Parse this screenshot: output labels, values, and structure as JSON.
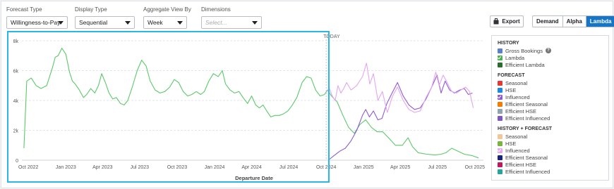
{
  "filters": [
    {
      "key": "forecast_type",
      "label": "Forecast Type",
      "value": "Willingness-to-Pay",
      "placeholder": ""
    },
    {
      "key": "display_type",
      "label": "Display Type",
      "value": "Sequential",
      "placeholder": ""
    },
    {
      "key": "aggregate_view",
      "label": "Aggregate View By",
      "value": "Week",
      "placeholder": ""
    },
    {
      "key": "dimensions",
      "label": "Dimensions",
      "value": "",
      "placeholder": "Select..."
    }
  ],
  "toolbar": {
    "export_label": "Export",
    "modes": [
      "Demand",
      "Alpha",
      "Lambda"
    ],
    "active_mode": "Lambda"
  },
  "legend": {
    "groups": [
      {
        "title": "HISTORY",
        "items": [
          {
            "label": "Gross Bookings",
            "color": "#5b7fc9",
            "checked": false,
            "help": true
          },
          {
            "label": "Lambda",
            "color": "#4caf50",
            "checked": true,
            "help": false
          },
          {
            "label": "Efficient Lambda",
            "color": "#2e6b2e",
            "checked": false,
            "help": false
          }
        ]
      },
      {
        "title": "FORECAST",
        "items": [
          {
            "label": "Seasonal",
            "color": "#e53935",
            "checked": false
          },
          {
            "label": "HSE",
            "color": "#1e88e5",
            "checked": false
          },
          {
            "label": "Influenced",
            "color": "#8e5bd1",
            "checked": true
          },
          {
            "label": "Efficient Seasonal",
            "color": "#f57c00",
            "checked": false
          },
          {
            "label": "Efficient HSE",
            "color": "#90a4ae",
            "checked": false
          },
          {
            "label": "Efficient Influenced",
            "color": "#7e57c2",
            "checked": false
          }
        ]
      },
      {
        "title": "HISTORY + FORECAST",
        "items": [
          {
            "label": "Seasonal",
            "color": "#f5c59a",
            "checked": false
          },
          {
            "label": "HSE",
            "color": "#7cb342",
            "checked": false
          },
          {
            "label": "Influenced",
            "color": "#e7a7f0",
            "checked": true
          },
          {
            "label": "Efficient Seasonal",
            "color": "#1a237e",
            "checked": false
          },
          {
            "label": "Efficient HSE",
            "color": "#c2185b",
            "checked": false
          },
          {
            "label": "Efficient Influenced",
            "color": "#26a69a",
            "checked": false
          }
        ]
      }
    ]
  },
  "chart_data": {
    "type": "line",
    "xlabel": "Departure Date",
    "ylabel": "",
    "ylim": [
      0,
      8000
    ],
    "yticks": [
      0,
      2000,
      4000,
      6000,
      8000
    ],
    "ytick_labels": [
      "0",
      "2k",
      "4k",
      "6k",
      "8k"
    ],
    "xlim": [
      "2022-09-15",
      "2025-10-22"
    ],
    "xticks": [
      "2022-10-01",
      "2023-01-01",
      "2023-04-01",
      "2023-07-01",
      "2023-10-01",
      "2024-01-01",
      "2024-04-01",
      "2024-07-01",
      "2024-10-01",
      "2025-01-01",
      "2025-04-01",
      "2025-07-01",
      "2025-10-01"
    ],
    "xtick_labels": [
      "Oct 2022",
      "Jan 2023",
      "Apr 2023",
      "Jul 2023",
      "Oct 2023",
      "Jan 2024",
      "Apr 2024",
      "Jul 2024",
      "Oct 2024",
      "Jan 2025",
      "Apr 2025",
      "Jul 2025",
      "Oct 2025"
    ],
    "today_label": "TODAY",
    "today_date": "2024-10-01",
    "grid": true,
    "series": [
      {
        "name": "Lambda",
        "color": "#5cc96a",
        "points": [
          [
            "2022-09-20",
            800
          ],
          [
            "2022-09-27",
            5300
          ],
          [
            "2022-10-08",
            5500
          ],
          [
            "2022-10-20",
            5000
          ],
          [
            "2022-11-01",
            4800
          ],
          [
            "2022-11-15",
            5000
          ],
          [
            "2022-11-29",
            6200
          ],
          [
            "2022-12-06",
            6900
          ],
          [
            "2022-12-13",
            7000
          ],
          [
            "2022-12-22",
            7500
          ],
          [
            "2023-01-01",
            7100
          ],
          [
            "2023-01-10",
            5900
          ],
          [
            "2023-01-17",
            5300
          ],
          [
            "2023-01-24",
            5100
          ],
          [
            "2023-02-03",
            4700
          ],
          [
            "2023-02-13",
            4200
          ],
          [
            "2023-02-21",
            4400
          ],
          [
            "2023-03-03",
            4800
          ],
          [
            "2023-03-13",
            4500
          ],
          [
            "2023-03-22",
            5000
          ],
          [
            "2023-03-30",
            5800
          ],
          [
            "2023-04-08",
            5200
          ],
          [
            "2023-04-17",
            4500
          ],
          [
            "2023-04-26",
            4100
          ],
          [
            "2023-05-05",
            4200
          ],
          [
            "2023-05-15",
            3800
          ],
          [
            "2023-05-24",
            3700
          ],
          [
            "2023-06-02",
            4000
          ],
          [
            "2023-06-13",
            4900
          ],
          [
            "2023-06-25",
            6000
          ],
          [
            "2023-07-06",
            6700
          ],
          [
            "2023-07-17",
            6300
          ],
          [
            "2023-07-27",
            5300
          ],
          [
            "2023-08-08",
            4700
          ],
          [
            "2023-08-20",
            4500
          ],
          [
            "2023-09-01",
            4600
          ],
          [
            "2023-09-13",
            4900
          ],
          [
            "2023-09-24",
            5400
          ],
          [
            "2023-10-05",
            5200
          ],
          [
            "2023-10-16",
            4600
          ],
          [
            "2023-10-27",
            4300
          ],
          [
            "2023-11-06",
            4400
          ],
          [
            "2023-11-17",
            4600
          ],
          [
            "2023-11-28",
            4400
          ],
          [
            "2023-12-07",
            4600
          ],
          [
            "2023-12-18",
            5300
          ],
          [
            "2023-12-29",
            5800
          ],
          [
            "2024-01-10",
            5600
          ],
          [
            "2024-01-20",
            6000
          ],
          [
            "2024-01-28",
            5100
          ],
          [
            "2024-02-08",
            4700
          ],
          [
            "2024-02-19",
            4500
          ],
          [
            "2024-03-01",
            4600
          ],
          [
            "2024-03-11",
            4200
          ],
          [
            "2024-03-22",
            3800
          ],
          [
            "2024-04-01",
            4300
          ],
          [
            "2024-04-11",
            3700
          ],
          [
            "2024-04-20",
            3500
          ],
          [
            "2024-04-29",
            3700
          ],
          [
            "2024-05-08",
            3300
          ],
          [
            "2024-05-18",
            2900
          ],
          [
            "2024-05-28",
            3000
          ],
          [
            "2024-06-08",
            3000
          ],
          [
            "2024-06-18",
            3100
          ],
          [
            "2024-06-29",
            3300
          ],
          [
            "2024-07-10",
            3700
          ],
          [
            "2024-07-21",
            4200
          ],
          [
            "2024-08-03",
            5200
          ],
          [
            "2024-08-14",
            5600
          ],
          [
            "2024-08-25",
            5500
          ],
          [
            "2024-09-05",
            4700
          ],
          [
            "2024-09-16",
            4300
          ],
          [
            "2024-09-27",
            4400
          ],
          [
            "2024-10-04",
            4700
          ],
          [
            "2024-10-14",
            4300
          ],
          [
            "2024-10-28",
            3900
          ],
          [
            "2024-11-11",
            3000
          ],
          [
            "2024-11-25",
            2200
          ],
          [
            "2024-12-09",
            1800
          ],
          [
            "2024-12-23",
            2400
          ],
          [
            "2025-01-06",
            2700
          ],
          [
            "2025-01-20",
            2200
          ],
          [
            "2025-02-03",
            1900
          ],
          [
            "2025-02-17",
            1900
          ],
          [
            "2025-03-03",
            1500
          ],
          [
            "2025-03-20",
            1000
          ],
          [
            "2025-04-06",
            1000
          ],
          [
            "2025-04-20",
            1500
          ],
          [
            "2025-05-01",
            900
          ],
          [
            "2025-05-15",
            500
          ],
          [
            "2025-06-05",
            400
          ],
          [
            "2025-06-25",
            350
          ],
          [
            "2025-07-10",
            400
          ],
          [
            "2025-07-22",
            500
          ],
          [
            "2025-08-05",
            800
          ],
          [
            "2025-08-17",
            650
          ],
          [
            "2025-09-05",
            400
          ],
          [
            "2025-09-25",
            300
          ],
          [
            "2025-10-10",
            150
          ]
        ]
      },
      {
        "name": "Influenced",
        "color": "#8e5bd1",
        "points": [
          [
            "2024-10-06",
            0
          ],
          [
            "2024-10-20",
            300
          ],
          [
            "2024-11-03",
            600
          ],
          [
            "2024-11-17",
            800
          ],
          [
            "2024-12-01",
            1300
          ],
          [
            "2024-12-15",
            2000
          ],
          [
            "2024-12-29",
            3000
          ],
          [
            "2025-01-06",
            3400
          ],
          [
            "2025-01-15",
            2900
          ],
          [
            "2025-01-25",
            3300
          ],
          [
            "2025-02-05",
            2700
          ],
          [
            "2025-02-15",
            2800
          ],
          [
            "2025-02-27",
            3800
          ],
          [
            "2025-03-10",
            4400
          ],
          [
            "2025-03-25",
            5200
          ],
          [
            "2025-04-08",
            4300
          ],
          [
            "2025-04-22",
            3700
          ],
          [
            "2025-05-06",
            3400
          ],
          [
            "2025-05-20",
            3500
          ],
          [
            "2025-06-03",
            4100
          ],
          [
            "2025-06-17",
            4900
          ],
          [
            "2025-06-30",
            5700
          ],
          [
            "2025-07-10",
            4500
          ],
          [
            "2025-07-20",
            5300
          ],
          [
            "2025-07-31",
            4700
          ],
          [
            "2025-08-12",
            4500
          ],
          [
            "2025-08-25",
            4700
          ],
          [
            "2025-09-05",
            4800
          ],
          [
            "2025-09-15",
            4400
          ],
          [
            "2025-09-25",
            4500
          ]
        ]
      },
      {
        "name": "Influenced (History + Forecast)",
        "color": "#e3a6ef",
        "points": [
          [
            "2024-10-02",
            4600
          ],
          [
            "2024-10-09",
            4800
          ],
          [
            "2024-10-16",
            4300
          ],
          [
            "2024-10-23",
            4000
          ],
          [
            "2024-10-30",
            5000
          ],
          [
            "2024-11-06",
            4500
          ],
          [
            "2024-11-13",
            4800
          ],
          [
            "2024-11-20",
            5200
          ],
          [
            "2024-12-01",
            4700
          ],
          [
            "2024-12-15",
            5000
          ],
          [
            "2024-12-29",
            5600
          ],
          [
            "2025-01-08",
            6500
          ],
          [
            "2025-01-16",
            5100
          ],
          [
            "2025-01-25",
            5800
          ],
          [
            "2025-02-05",
            4000
          ],
          [
            "2025-02-16",
            4600
          ],
          [
            "2025-02-28",
            3200
          ],
          [
            "2025-03-13",
            4300
          ],
          [
            "2025-03-25",
            4900
          ],
          [
            "2025-04-08",
            4000
          ],
          [
            "2025-04-22",
            3400
          ],
          [
            "2025-05-06",
            3200
          ],
          [
            "2025-05-20",
            3300
          ],
          [
            "2025-06-03",
            4200
          ],
          [
            "2025-06-17",
            4900
          ],
          [
            "2025-06-27",
            5900
          ],
          [
            "2025-07-05",
            5000
          ],
          [
            "2025-07-15",
            5700
          ],
          [
            "2025-07-25",
            5200
          ],
          [
            "2025-08-05",
            4600
          ],
          [
            "2025-08-17",
            4500
          ],
          [
            "2025-08-28",
            4700
          ],
          [
            "2025-09-08",
            4900
          ],
          [
            "2025-09-18",
            4600
          ],
          [
            "2025-09-27",
            3500
          ]
        ]
      }
    ]
  }
}
